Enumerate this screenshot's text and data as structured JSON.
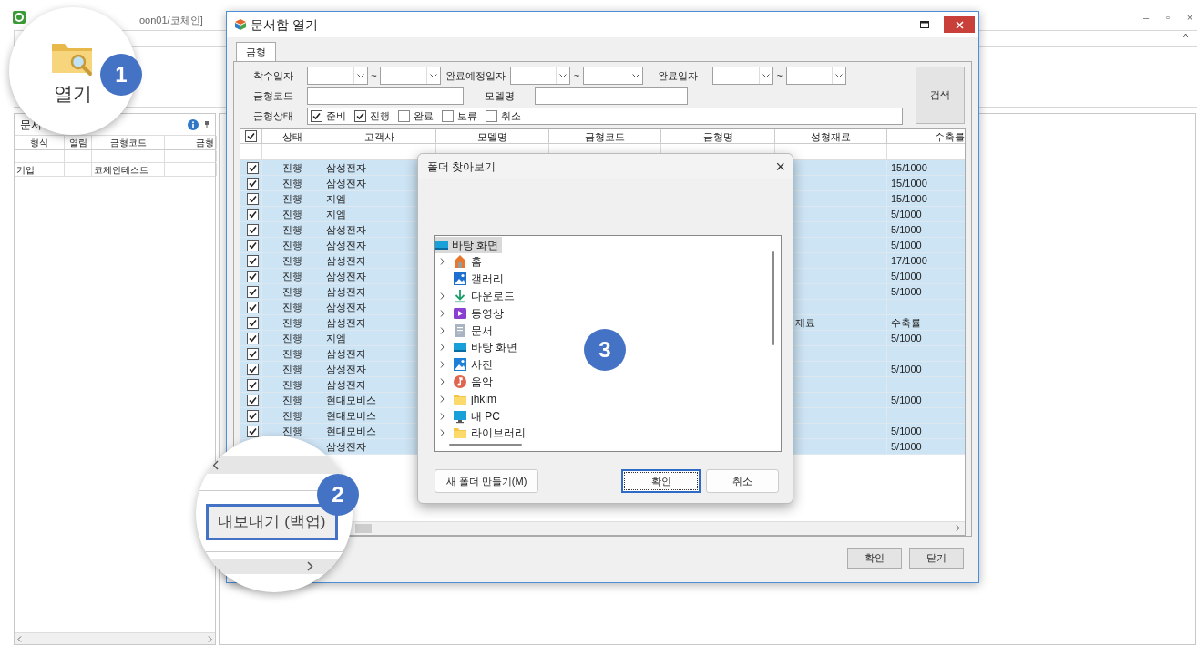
{
  "app": {
    "title": "oon01/코체인]",
    "window_controls": [
      "–",
      "▫",
      "×"
    ],
    "ribbon_collapse": "^"
  },
  "left_panel": {
    "title": "문서",
    "columns": [
      "형식",
      "열림",
      "금형코드",
      "금형"
    ],
    "rows": [
      [
        "기업",
        "",
        "코체인테스트",
        ""
      ]
    ]
  },
  "dialog": {
    "title": "문서함 열기",
    "tabs": [
      {
        "label": "금형",
        "selected": true
      }
    ],
    "date_filters": [
      {
        "label": "착수일자",
        "separator": "~"
      },
      {
        "label": "완료예정일자",
        "separator": "~"
      },
      {
        "label": "완료일자",
        "separator": "~"
      }
    ],
    "text_filters": [
      {
        "label": "금형코드"
      },
      {
        "label": "모델명"
      }
    ],
    "status_label": "금형상태",
    "status_options": [
      {
        "label": "준비",
        "checked": true
      },
      {
        "label": "진행",
        "checked": true
      },
      {
        "label": "완료",
        "checked": false
      },
      {
        "label": "보류",
        "checked": false
      },
      {
        "label": "취소",
        "checked": false
      }
    ],
    "search_button": "검색",
    "grid": {
      "header_checked": true,
      "columns": [
        "상태",
        "고객사",
        "모델명",
        "금형코드",
        "금형명",
        "성형재료",
        "수축률"
      ],
      "rows": [
        {
          "checked": true,
          "status": "진행",
          "customer": "삼성전자",
          "shrinkage": "15/1000"
        },
        {
          "checked": true,
          "status": "진행",
          "customer": "삼성전자",
          "shrinkage": "15/1000"
        },
        {
          "checked": true,
          "status": "진행",
          "customer": "지엠",
          "shrinkage": "15/1000"
        },
        {
          "checked": true,
          "status": "진행",
          "customer": "지엠",
          "shrinkage": "5/1000"
        },
        {
          "checked": true,
          "status": "진행",
          "customer": "삼성전자",
          "shrinkage": "5/1000"
        },
        {
          "checked": true,
          "status": "진행",
          "customer": "삼성전자",
          "shrinkage": "5/1000"
        },
        {
          "checked": true,
          "status": "진행",
          "customer": "삼성전자",
          "shrinkage": "17/1000"
        },
        {
          "checked": true,
          "status": "진행",
          "customer": "삼성전자",
          "shrinkage": "5/1000"
        },
        {
          "checked": true,
          "status": "진행",
          "customer": "삼성전자",
          "shrinkage": "5/1000"
        },
        {
          "checked": true,
          "status": "진행",
          "customer": "삼성전자"
        },
        {
          "checked": true,
          "status": "진행",
          "customer": "삼성전자",
          "material": "재료",
          "shrinkage": "수축률"
        },
        {
          "checked": true,
          "status": "진행",
          "customer": "지엠",
          "shrinkage": "5/1000"
        },
        {
          "checked": true,
          "status": "진행",
          "customer": "삼성전자"
        },
        {
          "checked": true,
          "status": "진행",
          "customer": "삼성전자",
          "shrinkage": "5/1000"
        },
        {
          "checked": true,
          "status": "진행",
          "customer": "삼성전자"
        },
        {
          "checked": true,
          "status": "진행",
          "customer": "현대모비스",
          "shrinkage": "5/1000"
        },
        {
          "checked": true,
          "status": "진행",
          "customer": "현대모비스"
        },
        {
          "checked": true,
          "status": "진행",
          "customer": "현대모비스",
          "shrinkage": "5/1000"
        },
        {
          "customer": "삼성전자",
          "shrinkage": "5/1000"
        }
      ]
    },
    "buttons": [
      "확인",
      "닫기"
    ]
  },
  "folder_dialog": {
    "title": "폴더 찾아보기",
    "close": "×",
    "root": {
      "label": "바탕 화면",
      "selected": true
    },
    "items": [
      {
        "label": "홈",
        "kind": "home",
        "expandable": true
      },
      {
        "label": "갤러리",
        "kind": "gallery",
        "expandable": false
      },
      {
        "label": "다운로드",
        "kind": "download",
        "expandable": true
      },
      {
        "label": "동영상",
        "kind": "video",
        "expandable": true
      },
      {
        "label": "문서",
        "kind": "document",
        "expandable": true
      },
      {
        "label": "바탕 화면",
        "kind": "desktop",
        "expandable": true
      },
      {
        "label": "사진",
        "kind": "photo",
        "expandable": true
      },
      {
        "label": "음악",
        "kind": "music",
        "expandable": true
      },
      {
        "label": "jhkim",
        "kind": "folder",
        "expandable": true
      },
      {
        "label": "내 PC",
        "kind": "pc",
        "expandable": true
      },
      {
        "label": "라이브러리",
        "kind": "folder",
        "expandable": true
      }
    ],
    "buttons": [
      {
        "label": "새 폴더 만들기(M)",
        "focused": false
      },
      {
        "label": "확인",
        "focused": true
      },
      {
        "label": "취소",
        "focused": false
      }
    ]
  },
  "callouts": [
    {
      "badge": "1",
      "label": "열기"
    },
    {
      "badge": "2",
      "label": "내보내기 (백업)"
    },
    {
      "badge": "3"
    }
  ]
}
